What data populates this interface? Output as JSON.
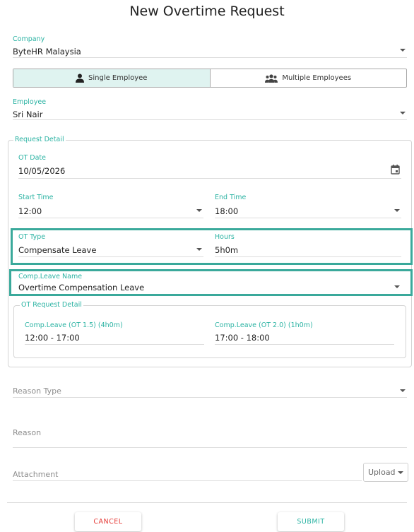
{
  "page": {
    "title": "New Overtime Request"
  },
  "company": {
    "label": "Company",
    "value": "ByteHR Malaysia"
  },
  "mode_toggle": {
    "single_label": "Single Employee",
    "multiple_label": "Multiple Employees",
    "selected": "single"
  },
  "employee": {
    "label": "Employee",
    "value": "Sri Nair"
  },
  "request_detail": {
    "legend": "Request Detail",
    "ot_date": {
      "label": "OT Date",
      "value": "10/05/2026"
    },
    "start_time": {
      "label": "Start Time",
      "value": "12:00"
    },
    "end_time": {
      "label": "End Time",
      "value": "18:00"
    },
    "ot_type": {
      "label": "OT Type",
      "value": "Compensate Leave"
    },
    "hours": {
      "label": "Hours",
      "value": "5h0m"
    },
    "comp_leave_name": {
      "label": "Comp.Leave Name",
      "value": "Overtime Compensation Leave"
    },
    "ot_request_detail": {
      "legend": "OT Request Detail",
      "items": [
        {
          "label": "Comp.Leave (OT 1.5) (4h0m)",
          "value": "12:00 - 17:00"
        },
        {
          "label": "Comp.Leave (OT 2.0) (1h0m)",
          "value": "17:00 - 18:00"
        }
      ]
    }
  },
  "reason_type": {
    "placeholder": "Reason Type"
  },
  "reason": {
    "placeholder": "Reason"
  },
  "attachment": {
    "placeholder": "Attachment",
    "upload_label": "Upload"
  },
  "actions": {
    "cancel_label": "CANCEL",
    "submit_label": "SUBMIT"
  },
  "colors": {
    "accent": "#2bb3a3",
    "highlight_border": "#3aa99b",
    "cancel": "#e53935",
    "toggle_active_bg": "#dff3f0"
  },
  "icons": {
    "single": "person-icon",
    "multiple": "group-icon",
    "date": "calendar-icon",
    "dropdown": "caret-down-icon"
  }
}
